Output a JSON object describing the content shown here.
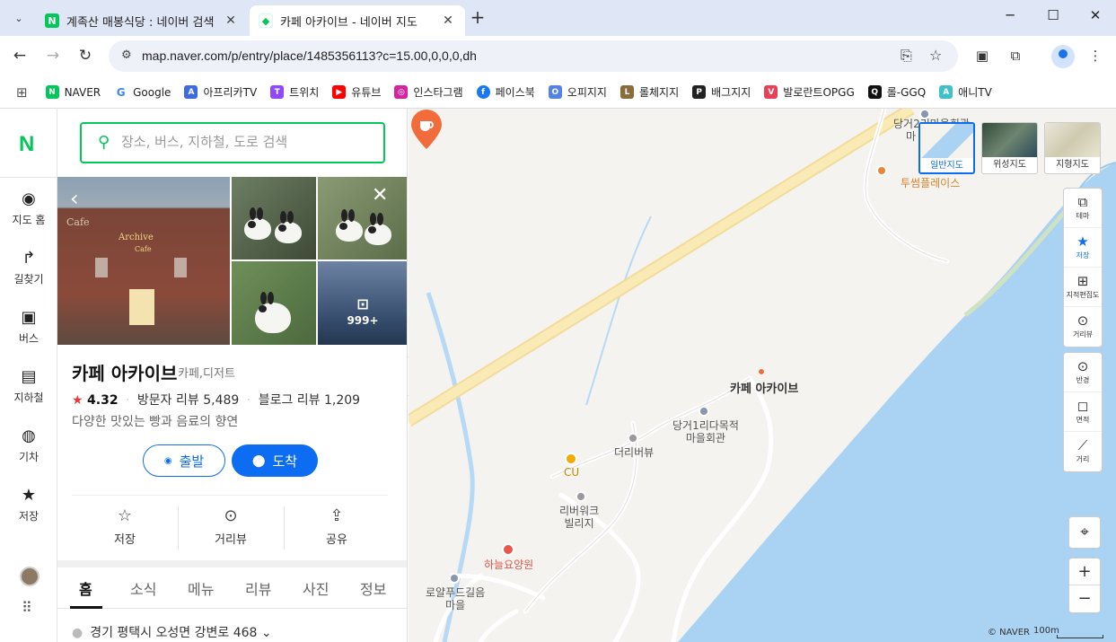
{
  "browser": {
    "tabs": [
      {
        "title": "계족산 매봉식당 : 네이버 검색",
        "favicon": "naver-n",
        "active": false
      },
      {
        "title": "카페 아카이브 - 네이버 지도",
        "favicon": "naver-map",
        "active": true
      }
    ],
    "url": "map.naver.com/p/entry/place/1485356113?c=15.00,0,0,0,dh",
    "bookmarks": [
      {
        "label": "NAVER",
        "icon": "N",
        "color": "#03c75a"
      },
      {
        "label": "Google",
        "icon": "G",
        "color": "#4285f4"
      },
      {
        "label": "아프리카TV",
        "icon": "A",
        "color": "#3b6de0"
      },
      {
        "label": "트위치",
        "icon": "T",
        "color": "#9146ff"
      },
      {
        "label": "유튜브",
        "icon": "▶",
        "color": "#ff0000"
      },
      {
        "label": "인스타그램",
        "icon": "◎",
        "color": "#d6249f"
      },
      {
        "label": "페이스북",
        "icon": "f",
        "color": "#1877f2"
      },
      {
        "label": "오피지지",
        "icon": "O",
        "color": "#5383e8"
      },
      {
        "label": "롤체지지",
        "icon": "L",
        "color": "#8a6b3a"
      },
      {
        "label": "배그지지",
        "icon": "P",
        "color": "#222222"
      },
      {
        "label": "발로란트OPGG",
        "icon": "V",
        "color": "#e84057"
      },
      {
        "label": "롤-GGQ",
        "icon": "Q",
        "color": "#111111"
      },
      {
        "label": "애니TV",
        "icon": "A",
        "color": "#3fc1c9"
      }
    ]
  },
  "sidebar": {
    "logo": "N",
    "items": [
      {
        "label": "지도 홈",
        "icon": "map-home-icon",
        "glyph": "◉"
      },
      {
        "label": "길찾기",
        "icon": "directions-icon",
        "glyph": "↱"
      },
      {
        "label": "버스",
        "icon": "bus-icon",
        "glyph": "▣"
      },
      {
        "label": "지하철",
        "icon": "subway-icon",
        "glyph": "▤"
      },
      {
        "label": "기차",
        "icon": "train-icon",
        "glyph": "◍"
      },
      {
        "label": "저장",
        "icon": "star-icon",
        "glyph": "★"
      }
    ]
  },
  "search": {
    "placeholder": "장소, 버스, 지하철, 도로 검색"
  },
  "place": {
    "photo_count": "999+",
    "photo_sign": "Archive",
    "photo_sign_sub": "Cafe",
    "photo_wall_text": "Cafe",
    "name": "카페 아카이브",
    "category": "카페,디저트",
    "rating": "4.32",
    "visitor_reviews_label": "방문자 리뷰",
    "visitor_reviews": "5,489",
    "blog_reviews_label": "블로그 리뷰",
    "blog_reviews": "1,209",
    "description": "다양한 맛있는 빵과 음료의 향연",
    "start_label": "출발",
    "arrive_label": "도착",
    "actions": [
      {
        "label": "저장",
        "icon": "star-outline-icon",
        "glyph": "☆"
      },
      {
        "label": "거리뷰",
        "icon": "streetview-icon",
        "glyph": "⊙"
      },
      {
        "label": "공유",
        "icon": "share-icon",
        "glyph": "⇪"
      }
    ],
    "tabs": [
      "홈",
      "소식",
      "메뉴",
      "리뷰",
      "사진",
      "정보"
    ],
    "active_tab": "홈",
    "address": "경기 평택시 오성면 강변로 468"
  },
  "map": {
    "map_types": [
      {
        "label": "일반지도",
        "active": true
      },
      {
        "label": "위성지도",
        "active": false
      },
      {
        "label": "지형지도",
        "active": false
      }
    ],
    "tools_top": [
      {
        "label": "테마",
        "icon": "layers-icon",
        "glyph": "⧉"
      },
      {
        "label": "저장",
        "icon": "star-icon",
        "glyph": "★"
      },
      {
        "label": "지적편집도",
        "icon": "cadastral-icon",
        "glyph": "⊞"
      },
      {
        "label": "거리뷰",
        "icon": "streetview-icon",
        "glyph": "⊙"
      }
    ],
    "tools_bottom": [
      {
        "label": "반경",
        "icon": "radius-icon",
        "glyph": "⊙"
      },
      {
        "label": "면적",
        "icon": "area-icon",
        "glyph": "◻"
      },
      {
        "label": "거리",
        "icon": "ruler-icon",
        "glyph": "⟋"
      }
    ],
    "labels": {
      "top_poi": "당거2리마을회관",
      "top_poi_2": "마",
      "twosome": "투썸플레이스",
      "target": "카페 아카이브",
      "village_hall": "당거1리다목적\n마을회관",
      "dereobeo": "더리버뷰",
      "cu": "CU",
      "riverwork": "리버워크\n빌리지",
      "haneul": "하늘요양원",
      "royal": "로얄푸드길음\n마을"
    },
    "credit": "© NAVER",
    "scale": "100m",
    "zoom_in": "+",
    "zoom_out": "−"
  }
}
